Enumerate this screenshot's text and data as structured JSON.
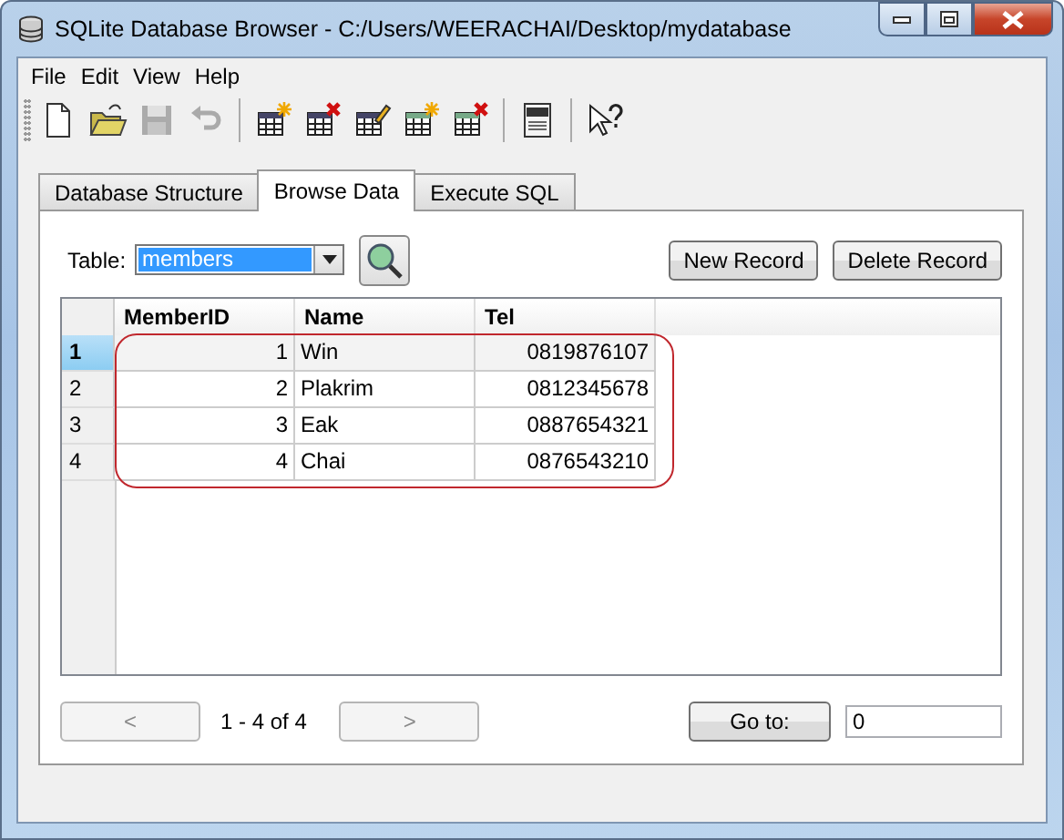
{
  "window": {
    "title": "SQLite Database Browser - C:/Users/WEERACHAI/Desktop/mydatabase"
  },
  "menu": [
    "File",
    "Edit",
    "View",
    "Help"
  ],
  "toolbar": [
    {
      "kind": "new",
      "disabled": false
    },
    {
      "kind": "open",
      "disabled": false
    },
    {
      "kind": "save",
      "disabled": true
    },
    {
      "kind": "undo",
      "disabled": true
    },
    {
      "kind": "sep"
    },
    {
      "kind": "create_table",
      "disabled": false
    },
    {
      "kind": "delete_table",
      "disabled": false
    },
    {
      "kind": "edit_table",
      "disabled": false
    },
    {
      "kind": "create_index",
      "disabled": false
    },
    {
      "kind": "delete_index",
      "disabled": false
    },
    {
      "kind": "sep"
    },
    {
      "kind": "log",
      "disabled": false
    },
    {
      "kind": "sep"
    },
    {
      "kind": "whats_this",
      "disabled": false
    }
  ],
  "tabs": [
    {
      "label": "Database Structure",
      "selected": false
    },
    {
      "label": "Browse Data",
      "selected": true
    },
    {
      "label": "Execute SQL",
      "selected": false
    }
  ],
  "table_picker": {
    "label": "Table:",
    "value": "members"
  },
  "buttons": [
    "New Record",
    "Delete Record"
  ],
  "grid": {
    "columns": [
      "MemberID",
      "Name",
      "Tel"
    ],
    "rows": [
      {
        "header": "1",
        "selected": true,
        "cells": [
          "1",
          "Win",
          "0819876107"
        ]
      },
      {
        "header": "2",
        "selected": false,
        "cells": [
          "2",
          "Plakrim",
          "0812345678"
        ]
      },
      {
        "header": "3",
        "selected": false,
        "cells": [
          "3",
          "Eak",
          "0887654321"
        ]
      },
      {
        "header": "4",
        "selected": false,
        "cells": [
          "4",
          "Chai",
          "0876543210"
        ]
      }
    ]
  },
  "pager": {
    "prev": {
      "label": "<",
      "disabled": true
    },
    "range": "1 - 4 of 4",
    "next": {
      "label": ">",
      "disabled": true
    },
    "goto_button": "Go to:",
    "goto_value": "0"
  }
}
